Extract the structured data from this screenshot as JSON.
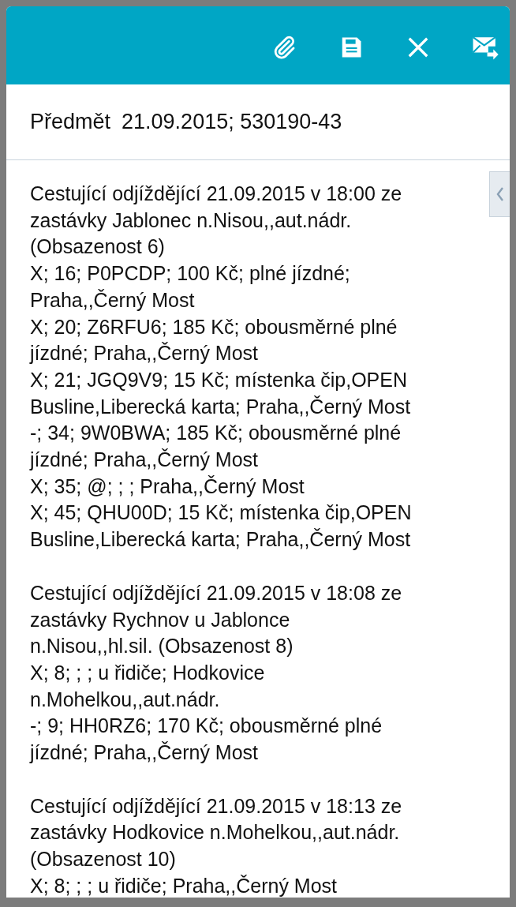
{
  "toolbar": {
    "actions": [
      {
        "kind": "attach"
      },
      {
        "kind": "save"
      },
      {
        "kind": "close"
      },
      {
        "kind": "send"
      }
    ]
  },
  "subject": {
    "label": "Předmět",
    "value": "21.09.2015; 530190-43"
  },
  "body": {
    "blocks": [
      {
        "lines": [
          "Cestující odjíždějící 21.09.2015 v 18:00 ze",
          "zastávky Jablonec n.Nisou,,aut.nádr.",
          "(Obsazenost 6)",
          "X; 16; P0PCDP; 100 Kč; plné jízdné;",
          "Praha,,Černý Most",
          "X; 20; Z6RFU6; 185 Kč; obousměrné plné",
          "jízdné; Praha,,Černý Most",
          "X; 21; JGQ9V9; 15 Kč; místenka čip,OPEN",
          "Busline,Liberecká karta; Praha,,Černý Most",
          "-; 34; 9W0BWA; 185 Kč; obousměrné plné",
          "jízdné; Praha,,Černý Most",
          "X; 35; @; ; ; Praha,,Černý Most",
          "X; 45; QHU00D; 15 Kč; místenka čip,OPEN",
          "Busline,Liberecká karta; Praha,,Černý Most"
        ]
      },
      {
        "lines": [
          "Cestující odjíždějící 21.09.2015 v 18:08 ze",
          "zastávky Rychnov u Jablonce",
          "n.Nisou,,hl.sil. (Obsazenost 8)",
          "X; 8; ; ; u řidiče; Hodkovice",
          "n.Mohelkou,,aut.nádr.",
          "-; 9; HH0RZ6; 170 Kč; obousměrné plné",
          "jízdné; Praha,,Černý Most"
        ]
      },
      {
        "lines": [
          "Cestující odjíždějící 21.09.2015 v 18:13 ze",
          "zastávky Hodkovice n.Mohelkou,,aut.nádr.",
          "(Obsazenost 10)",
          "X; 8; ; ; u řidiče; Praha,,Černý Most"
        ]
      }
    ]
  }
}
